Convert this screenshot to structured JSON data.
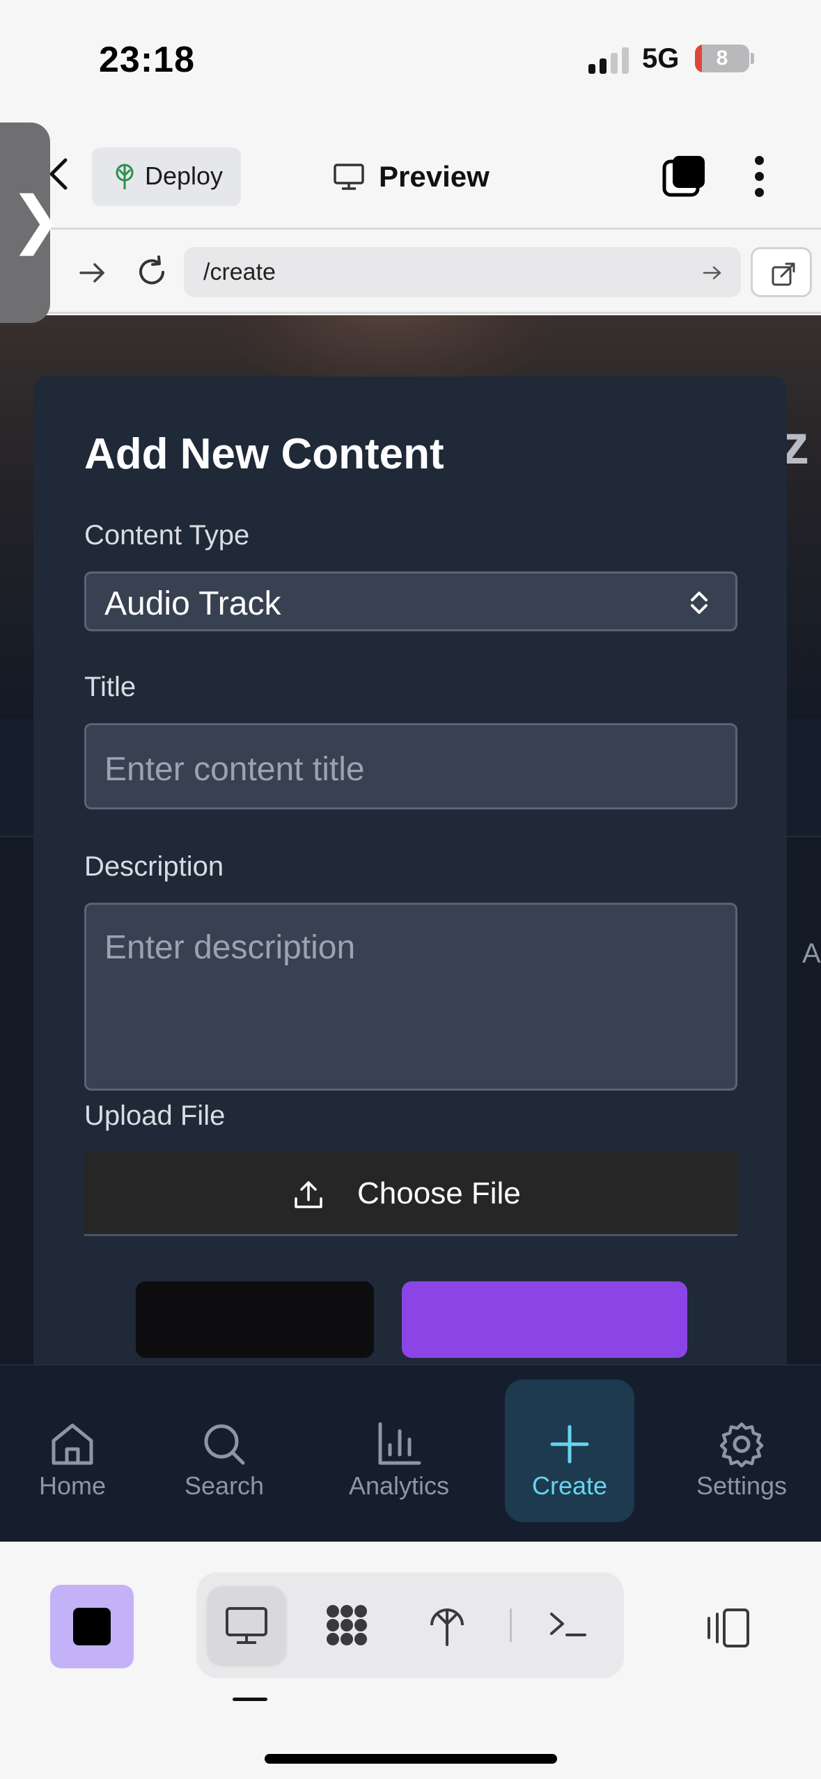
{
  "status_bar": {
    "time": "23:18",
    "network": "5G",
    "battery_level": "8",
    "battery_color": "#e0473a"
  },
  "app_bar": {
    "back_icon": "chevron-left-icon",
    "deploy_label": "Deploy",
    "deploy_icon": "tree-antenna-icon",
    "preview_label": "Preview",
    "preview_icon": "monitor-icon",
    "tabs_icon": "stacked-tabs-icon",
    "more_icon": "vertical-dots-icon"
  },
  "url_bar": {
    "path": "/create",
    "forward_icon": "arrow-right-icon",
    "reload_icon": "reload-icon",
    "go_icon": "arrow-right-icon",
    "external_icon": "external-link-icon"
  },
  "drawer": {
    "toggle_glyph": "❯"
  },
  "page": {
    "hero_title_fragment": "z",
    "side_fragment": "A"
  },
  "modal": {
    "title": "Add New Content",
    "content_type_label": "Content Type",
    "content_type_value": "Audio Track",
    "title_label": "Title",
    "title_placeholder": "Enter content title",
    "description_label": "Description",
    "description_placeholder": "Enter description",
    "upload_label": "Upload File",
    "choose_file_label": "Choose File",
    "accent_color": "#8b45e6"
  },
  "bottom_nav": {
    "items": [
      {
        "label": "Home",
        "icon": "home-icon"
      },
      {
        "label": "Search",
        "icon": "search-icon"
      },
      {
        "label": "Analytics",
        "icon": "bar-chart-icon"
      },
      {
        "label": "Create",
        "icon": "plus-icon",
        "active": true
      },
      {
        "label": "Settings",
        "icon": "gear-icon"
      }
    ],
    "active_color": "#67d4ee"
  },
  "toolbar": {
    "app_color": "#c3b2f7",
    "modes": [
      "monitor-icon",
      "grid-blob-icon",
      "tree-antenna-icon",
      "terminal-icon"
    ],
    "panel_icon": "side-panel-icon"
  }
}
